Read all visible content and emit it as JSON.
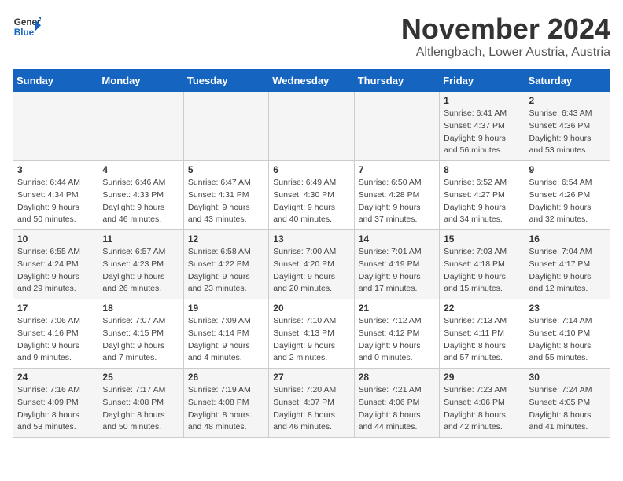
{
  "header": {
    "logo_line1": "General",
    "logo_line2": "Blue",
    "month": "November 2024",
    "location": "Altlengbach, Lower Austria, Austria"
  },
  "weekdays": [
    "Sunday",
    "Monday",
    "Tuesday",
    "Wednesday",
    "Thursday",
    "Friday",
    "Saturday"
  ],
  "weeks": [
    [
      {
        "day": "",
        "detail": ""
      },
      {
        "day": "",
        "detail": ""
      },
      {
        "day": "",
        "detail": ""
      },
      {
        "day": "",
        "detail": ""
      },
      {
        "day": "",
        "detail": ""
      },
      {
        "day": "1",
        "detail": "Sunrise: 6:41 AM\nSunset: 4:37 PM\nDaylight: 9 hours\nand 56 minutes."
      },
      {
        "day": "2",
        "detail": "Sunrise: 6:43 AM\nSunset: 4:36 PM\nDaylight: 9 hours\nand 53 minutes."
      }
    ],
    [
      {
        "day": "3",
        "detail": "Sunrise: 6:44 AM\nSunset: 4:34 PM\nDaylight: 9 hours\nand 50 minutes."
      },
      {
        "day": "4",
        "detail": "Sunrise: 6:46 AM\nSunset: 4:33 PM\nDaylight: 9 hours\nand 46 minutes."
      },
      {
        "day": "5",
        "detail": "Sunrise: 6:47 AM\nSunset: 4:31 PM\nDaylight: 9 hours\nand 43 minutes."
      },
      {
        "day": "6",
        "detail": "Sunrise: 6:49 AM\nSunset: 4:30 PM\nDaylight: 9 hours\nand 40 minutes."
      },
      {
        "day": "7",
        "detail": "Sunrise: 6:50 AM\nSunset: 4:28 PM\nDaylight: 9 hours\nand 37 minutes."
      },
      {
        "day": "8",
        "detail": "Sunrise: 6:52 AM\nSunset: 4:27 PM\nDaylight: 9 hours\nand 34 minutes."
      },
      {
        "day": "9",
        "detail": "Sunrise: 6:54 AM\nSunset: 4:26 PM\nDaylight: 9 hours\nand 32 minutes."
      }
    ],
    [
      {
        "day": "10",
        "detail": "Sunrise: 6:55 AM\nSunset: 4:24 PM\nDaylight: 9 hours\nand 29 minutes."
      },
      {
        "day": "11",
        "detail": "Sunrise: 6:57 AM\nSunset: 4:23 PM\nDaylight: 9 hours\nand 26 minutes."
      },
      {
        "day": "12",
        "detail": "Sunrise: 6:58 AM\nSunset: 4:22 PM\nDaylight: 9 hours\nand 23 minutes."
      },
      {
        "day": "13",
        "detail": "Sunrise: 7:00 AM\nSunset: 4:20 PM\nDaylight: 9 hours\nand 20 minutes."
      },
      {
        "day": "14",
        "detail": "Sunrise: 7:01 AM\nSunset: 4:19 PM\nDaylight: 9 hours\nand 17 minutes."
      },
      {
        "day": "15",
        "detail": "Sunrise: 7:03 AM\nSunset: 4:18 PM\nDaylight: 9 hours\nand 15 minutes."
      },
      {
        "day": "16",
        "detail": "Sunrise: 7:04 AM\nSunset: 4:17 PM\nDaylight: 9 hours\nand 12 minutes."
      }
    ],
    [
      {
        "day": "17",
        "detail": "Sunrise: 7:06 AM\nSunset: 4:16 PM\nDaylight: 9 hours\nand 9 minutes."
      },
      {
        "day": "18",
        "detail": "Sunrise: 7:07 AM\nSunset: 4:15 PM\nDaylight: 9 hours\nand 7 minutes."
      },
      {
        "day": "19",
        "detail": "Sunrise: 7:09 AM\nSunset: 4:14 PM\nDaylight: 9 hours\nand 4 minutes."
      },
      {
        "day": "20",
        "detail": "Sunrise: 7:10 AM\nSunset: 4:13 PM\nDaylight: 9 hours\nand 2 minutes."
      },
      {
        "day": "21",
        "detail": "Sunrise: 7:12 AM\nSunset: 4:12 PM\nDaylight: 9 hours\nand 0 minutes."
      },
      {
        "day": "22",
        "detail": "Sunrise: 7:13 AM\nSunset: 4:11 PM\nDaylight: 8 hours\nand 57 minutes."
      },
      {
        "day": "23",
        "detail": "Sunrise: 7:14 AM\nSunset: 4:10 PM\nDaylight: 8 hours\nand 55 minutes."
      }
    ],
    [
      {
        "day": "24",
        "detail": "Sunrise: 7:16 AM\nSunset: 4:09 PM\nDaylight: 8 hours\nand 53 minutes."
      },
      {
        "day": "25",
        "detail": "Sunrise: 7:17 AM\nSunset: 4:08 PM\nDaylight: 8 hours\nand 50 minutes."
      },
      {
        "day": "26",
        "detail": "Sunrise: 7:19 AM\nSunset: 4:08 PM\nDaylight: 8 hours\nand 48 minutes."
      },
      {
        "day": "27",
        "detail": "Sunrise: 7:20 AM\nSunset: 4:07 PM\nDaylight: 8 hours\nand 46 minutes."
      },
      {
        "day": "28",
        "detail": "Sunrise: 7:21 AM\nSunset: 4:06 PM\nDaylight: 8 hours\nand 44 minutes."
      },
      {
        "day": "29",
        "detail": "Sunrise: 7:23 AM\nSunset: 4:06 PM\nDaylight: 8 hours\nand 42 minutes."
      },
      {
        "day": "30",
        "detail": "Sunrise: 7:24 AM\nSunset: 4:05 PM\nDaylight: 8 hours\nand 41 minutes."
      }
    ]
  ]
}
